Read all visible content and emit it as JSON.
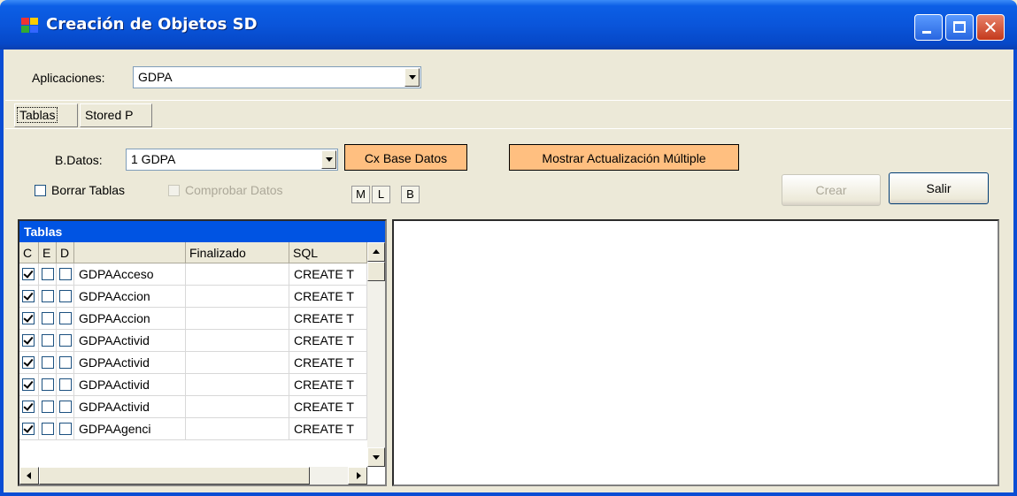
{
  "window": {
    "title": "Creación de Objetos SD"
  },
  "app_selector": {
    "label": "Aplicaciones:",
    "value": "GDPA"
  },
  "tabs": [
    {
      "label": "Tablas",
      "active": true
    },
    {
      "label": "Stored P",
      "active": false
    }
  ],
  "db_selector": {
    "label": "B.Datos:",
    "value": "1 GDPA"
  },
  "buttons": {
    "cx_base_datos": "Cx Base Datos",
    "mostrar_actualizacion": "Mostrar Actualización Múltiple",
    "crear": "Crear",
    "salir": "Salir",
    "m": "M",
    "l": "L",
    "b": "B"
  },
  "options": {
    "borrar_tablas": "Borrar Tablas",
    "comprobar_datos": "Comprobar Datos"
  },
  "grid": {
    "caption": "Tablas",
    "columns": [
      "C",
      "E",
      "D",
      "",
      "Finalizado",
      "SQL"
    ],
    "rows": [
      {
        "c": true,
        "e": false,
        "d": false,
        "name": "GDPAAcceso",
        "finalizado": "",
        "sql": "CREATE T"
      },
      {
        "c": true,
        "e": false,
        "d": false,
        "name": "GDPAAccion",
        "finalizado": "",
        "sql": "CREATE T"
      },
      {
        "c": true,
        "e": false,
        "d": false,
        "name": "GDPAAccion",
        "finalizado": "",
        "sql": "CREATE T"
      },
      {
        "c": true,
        "e": false,
        "d": false,
        "name": "GDPAActivid",
        "finalizado": "",
        "sql": "CREATE T"
      },
      {
        "c": true,
        "e": false,
        "d": false,
        "name": "GDPAActivid",
        "finalizado": "",
        "sql": "CREATE T"
      },
      {
        "c": true,
        "e": false,
        "d": false,
        "name": "GDPAActivid",
        "finalizado": "",
        "sql": "CREATE T"
      },
      {
        "c": true,
        "e": false,
        "d": false,
        "name": "GDPAActivid",
        "finalizado": "",
        "sql": "CREATE T"
      },
      {
        "c": true,
        "e": false,
        "d": false,
        "name": "GDPAAgenci",
        "finalizado": "",
        "sql": "CREATE T"
      }
    ]
  },
  "colors": {
    "titlebar": "#0A55DA",
    "accent_button": "#FFBF80",
    "grid_caption": "#0054E3",
    "window_bg": "#ECE9D8"
  },
  "icons": [
    "app-icon",
    "minimize-icon",
    "maximize-icon",
    "close-icon",
    "chevron-down-icon",
    "checkbox-icon",
    "scroll-up-icon",
    "scroll-down-icon",
    "scroll-left-icon",
    "scroll-right-icon"
  ]
}
